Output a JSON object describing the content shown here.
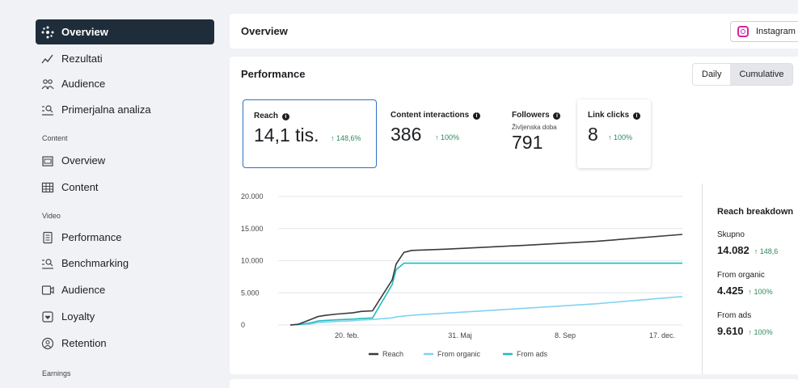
{
  "sidebar": {
    "items": [
      {
        "label": "Overview",
        "icon": "overview-icon",
        "active": true
      },
      {
        "label": "Rezultati",
        "icon": "results-icon"
      },
      {
        "label": "Audience",
        "icon": "audience-icon"
      },
      {
        "label": "Primerjalna analiza",
        "icon": "benchmark-icon"
      }
    ],
    "section_content": "Content",
    "content_items": [
      {
        "label": "Overview",
        "icon": "overview-icon"
      },
      {
        "label": "Content",
        "icon": "table-icon"
      }
    ],
    "section_video": "Video",
    "video_items": [
      {
        "label": "Performance",
        "icon": "performance-icon"
      },
      {
        "label": "Benchmarking",
        "icon": "benchmark-icon"
      },
      {
        "label": "Audience",
        "icon": "video-audience-icon"
      },
      {
        "label": "Loyalty",
        "icon": "loyalty-icon"
      },
      {
        "label": "Retention",
        "icon": "retention-icon"
      }
    ],
    "section_earnings": "Earnings"
  },
  "header": {
    "title": "Overview",
    "platform": "Instagram"
  },
  "performance": {
    "title": "Performance",
    "toggle": {
      "daily": "Daily",
      "cumulative": "Cumulative",
      "selected": "Cumulative"
    },
    "metrics": {
      "reach": {
        "label": "Reach",
        "value": "14,1 tis.",
        "change": "↑ 148,6%"
      },
      "interactions": {
        "label": "Content interactions",
        "value": "386",
        "change": "↑ 100%"
      },
      "followers": {
        "label": "Followers",
        "sublabel": "Življenska doba",
        "value": "791"
      },
      "link_clicks": {
        "label": "Link clicks",
        "value": "8",
        "change": "↑ 100%"
      }
    }
  },
  "chart_data": {
    "type": "line",
    "y_ticks": [
      "20.000",
      "15.000",
      "10.000",
      "5.000",
      "0"
    ],
    "x_ticks": [
      "20. feb.",
      "31. Maj",
      "8. Sep",
      "17. dec."
    ],
    "ylim": [
      0,
      20000
    ],
    "x": [
      0,
      2,
      5,
      7,
      9,
      12,
      16,
      18,
      21,
      26,
      27,
      29,
      31,
      33,
      40,
      60,
      78,
      100
    ],
    "series": [
      {
        "name": "Reach",
        "color": "#3a3a3a",
        "values": [
          0,
          100,
          800,
          1300,
          1500,
          1700,
          1900,
          2100,
          2200,
          7000,
          9500,
          11300,
          11600,
          11650,
          11800,
          12400,
          13000,
          14082
        ]
      },
      {
        "name": "From organic",
        "color": "#7fd3f2",
        "values": [
          0,
          50,
          150,
          350,
          450,
          550,
          650,
          750,
          850,
          1100,
          1250,
          1400,
          1500,
          1600,
          1850,
          2600,
          3300,
          4425
        ]
      },
      {
        "name": "From ads",
        "color": "#1fbdbd",
        "values": [
          0,
          50,
          300,
          600,
          700,
          800,
          900,
          1000,
          1100,
          6300,
          8600,
          9610,
          9610,
          9610,
          9610,
          9610,
          9610,
          9610
        ]
      }
    ]
  },
  "breakdown": {
    "title": "Reach breakdown",
    "total_label": "Skupno",
    "total_value": "14.082",
    "total_change": "↑ 148,6",
    "organic_label": "From organic",
    "organic_value": "4.425",
    "organic_change": "↑ 100%",
    "ads_label": "From ads",
    "ads_value": "9.610",
    "ads_change": "↑ 100%"
  }
}
